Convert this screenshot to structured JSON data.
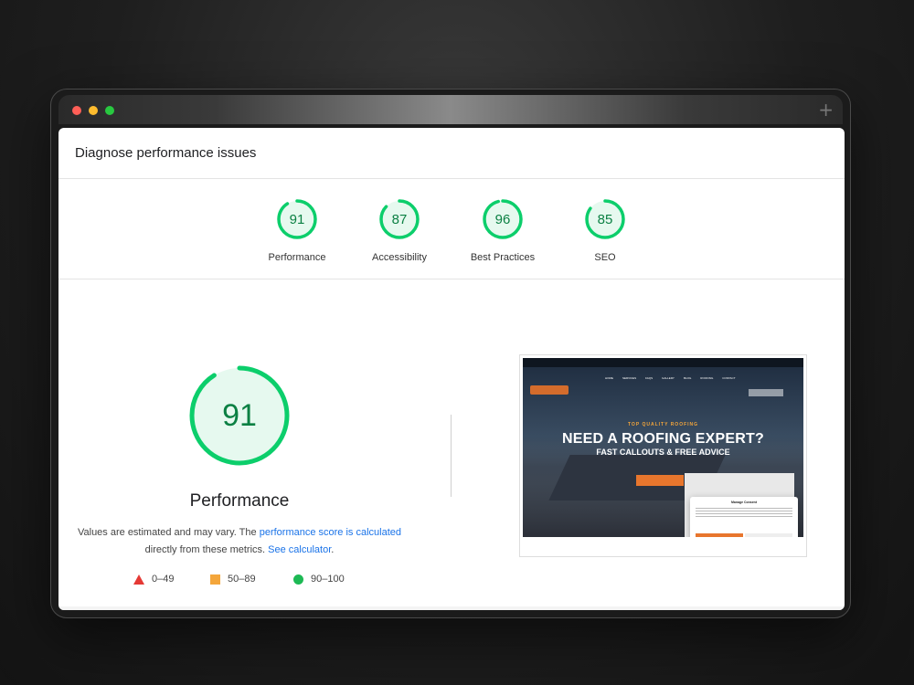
{
  "page_title": "Diagnose performance issues",
  "scores": [
    {
      "value": 91,
      "label": "Performance",
      "fraction": 0.91
    },
    {
      "value": 87,
      "label": "Accessibility",
      "fraction": 0.87
    },
    {
      "value": 96,
      "label": "Best Practices",
      "fraction": 0.96
    },
    {
      "value": 85,
      "label": "SEO",
      "fraction": 0.85
    }
  ],
  "main": {
    "score": 91,
    "fraction": 0.91,
    "title": "Performance",
    "desc_pre": "Values are estimated and may vary. The ",
    "desc_link1": "performance score is calculated",
    "desc_mid": " directly from these metrics. ",
    "desc_link2": "See calculator",
    "desc_post": "."
  },
  "legend": [
    {
      "range": "0–49",
      "shape": "triangle"
    },
    {
      "range": "50–89",
      "shape": "square"
    },
    {
      "range": "90–100",
      "shape": "circle"
    }
  ],
  "screenshot": {
    "kicker": "TOP QUALITY ROOFING",
    "headline": "NEED A ROOFING EXPERT?",
    "subheadline": "FAST CALLOUTS & FREE ADVICE",
    "nav": [
      "HOME",
      "SERVICES",
      "FAQS",
      "GALLERY",
      "BLOG",
      "ROOFING",
      "CONTACT"
    ],
    "consent_title": "Manage Consent"
  },
  "colors": {
    "pass": "#0cce6b",
    "pass_text": "#0b8043",
    "pass_bg": "#e6f9ef",
    "fail": "#e53935",
    "average": "#f4a63b",
    "link": "#1a73e8"
  }
}
